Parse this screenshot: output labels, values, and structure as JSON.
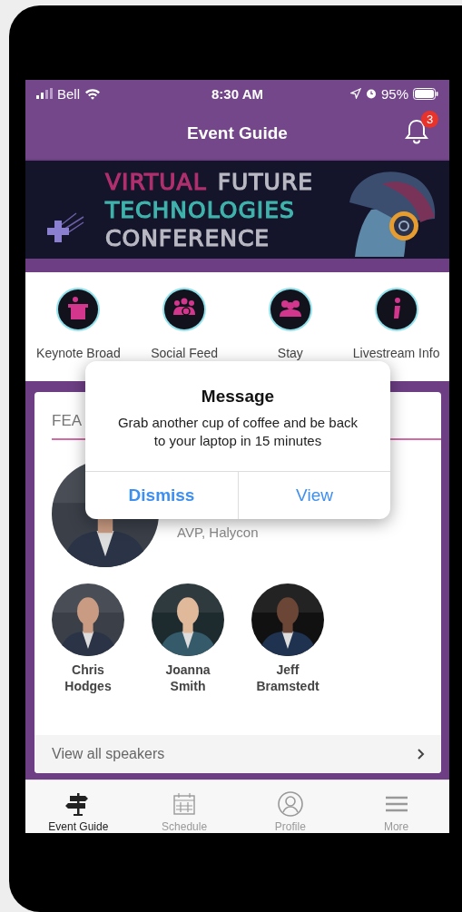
{
  "status_bar": {
    "carrier": "Bell",
    "time": "8:30 AM",
    "battery": "95%"
  },
  "nav_bar": {
    "title": "Event Guide",
    "notification_count": "3"
  },
  "banner": {
    "lines": [
      {
        "words": [
          {
            "text": "VIRTUAL",
            "color": "#b0306e"
          },
          {
            "text": "FUTURE",
            "color": "#b9b9c4"
          }
        ]
      },
      {
        "words": [
          {
            "text": "TECHNOLOGIES",
            "color": "#3fb3ac"
          }
        ]
      },
      {
        "words": [
          {
            "text": "CONFERENCE",
            "color": "#b9b9c4"
          }
        ]
      }
    ]
  },
  "quick_links": [
    {
      "label": "Keynote Broad",
      "kind": "podium"
    },
    {
      "label": "Social Feed",
      "kind": "group"
    },
    {
      "label": "Stay",
      "kind": "people"
    },
    {
      "label": "Livestream Info",
      "kind": "info"
    }
  ],
  "featured": {
    "heading": "FEA",
    "lead_speaker": {
      "title": "AVP, Halycon"
    },
    "speakers": [
      {
        "name": "Chris Hodges"
      },
      {
        "name": "Joanna Smith"
      },
      {
        "name": "Jeff Bramstedt"
      }
    ],
    "view_all": "View all speakers"
  },
  "alert": {
    "title": "Message",
    "message": "Grab another cup of coffee and be back to your laptop in 15 minutes",
    "buttons": [
      {
        "label": "Dismiss",
        "kind": "preferred"
      },
      {
        "label": "View",
        "kind": "default"
      }
    ]
  },
  "tab_bar": [
    {
      "label": "Event Guide",
      "kind": "signpost",
      "selected": true
    },
    {
      "label": "Schedule",
      "kind": "calendar",
      "selected": false
    },
    {
      "label": "Profile",
      "kind": "profile",
      "selected": false
    },
    {
      "label": "More",
      "kind": "menu",
      "selected": false
    }
  ]
}
